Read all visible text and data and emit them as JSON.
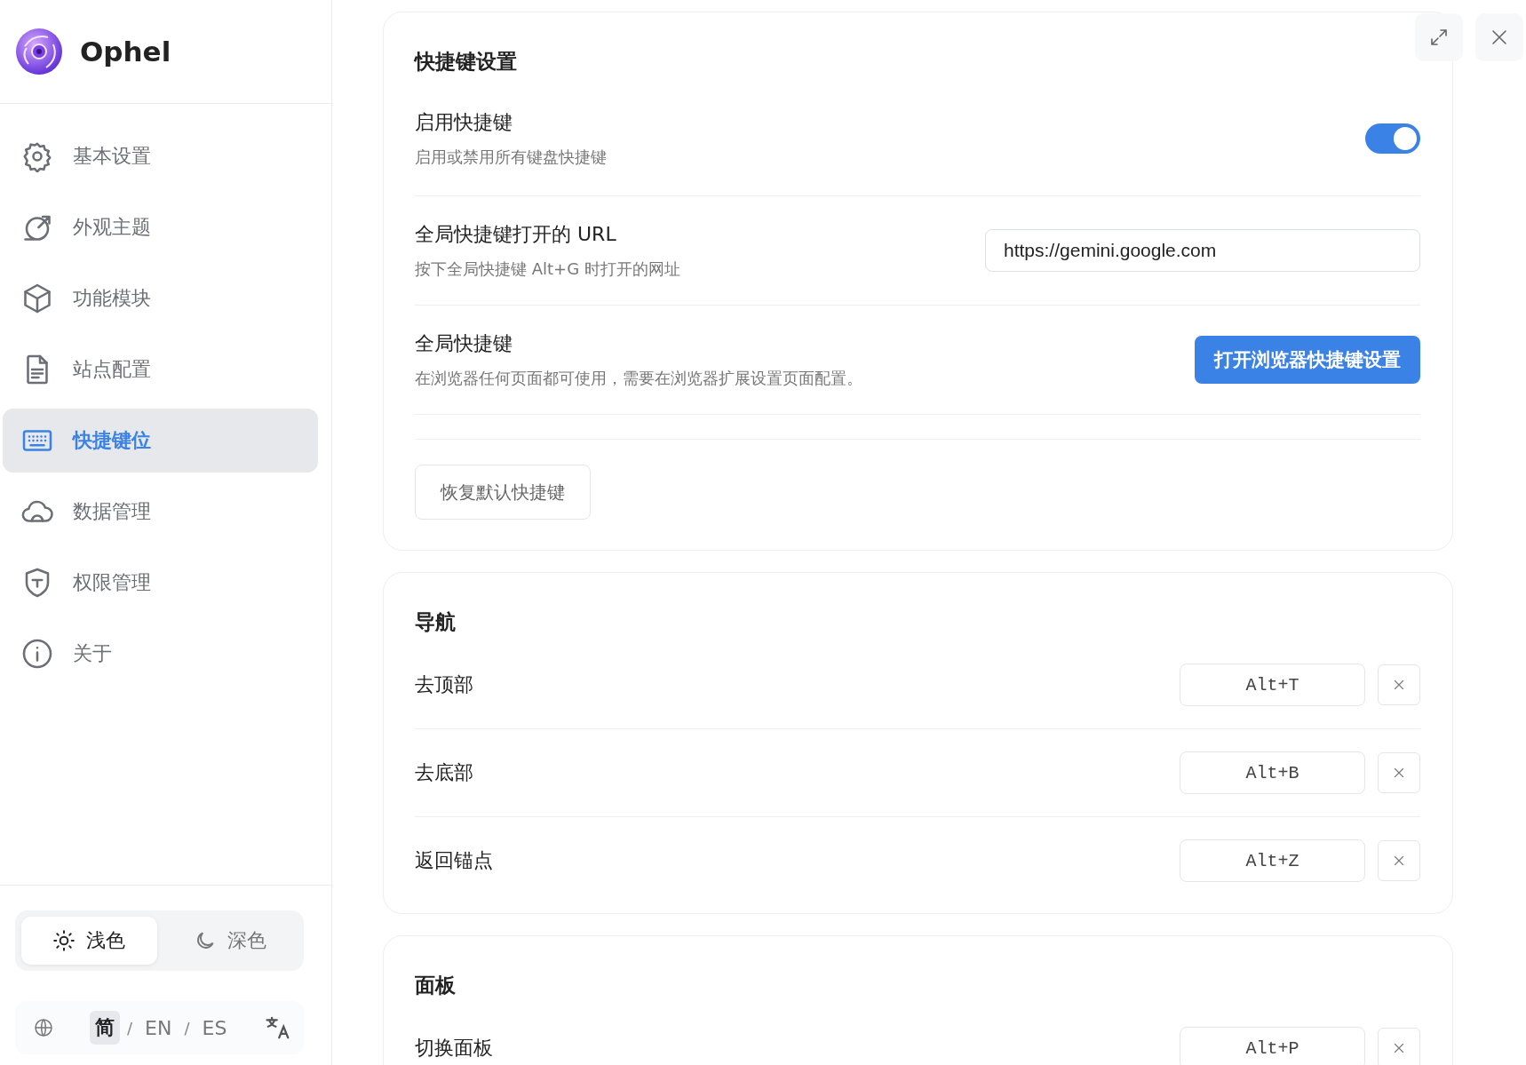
{
  "app": {
    "name": "Ophel"
  },
  "sidebar": {
    "items": [
      {
        "label": "基本设置",
        "selected": false
      },
      {
        "label": "外观主题",
        "selected": false
      },
      {
        "label": "功能模块",
        "selected": false
      },
      {
        "label": "站点配置",
        "selected": false
      },
      {
        "label": "快捷键位",
        "selected": true
      },
      {
        "label": "数据管理",
        "selected": false
      },
      {
        "label": "权限管理",
        "selected": false
      },
      {
        "label": "关于",
        "selected": false
      }
    ],
    "theme_options": [
      {
        "label": "浅色",
        "selected": true
      },
      {
        "label": "深色",
        "selected": false
      }
    ],
    "languages": [
      {
        "label": "简",
        "selected": true
      },
      {
        "label": "EN",
        "selected": false
      },
      {
        "label": "ES",
        "selected": false
      }
    ],
    "language_separator": "/"
  },
  "sections": [
    {
      "title": "快捷键设置",
      "rows": [
        {
          "kind": "toggle",
          "label": "启用快捷键",
          "description": "启用或禁用所有键盘快捷键",
          "on": true
        },
        {
          "kind": "input",
          "label": "全局快捷键打开的 URL",
          "description": "按下全局快捷键 Alt+G 时打开的网址",
          "value": "https://gemini.google.com"
        },
        {
          "kind": "button",
          "label": "全局快捷键",
          "description": "在浏览器任何页面都可使用，需要在浏览器扩展设置页面配置。",
          "button": "打开浏览器快捷键设置"
        }
      ],
      "footer_button": "恢复默认快捷键"
    },
    {
      "title": "导航",
      "rows": [
        {
          "kind": "shortcut",
          "label": "去顶部",
          "key": "Alt+T"
        },
        {
          "kind": "shortcut",
          "label": "去底部",
          "key": "Alt+B"
        },
        {
          "kind": "shortcut",
          "label": "返回锚点",
          "key": "Alt+Z"
        }
      ]
    },
    {
      "title": "面板",
      "rows": [
        {
          "kind": "shortcut",
          "label": "切换面板",
          "key": "Alt+P"
        }
      ]
    }
  ]
}
